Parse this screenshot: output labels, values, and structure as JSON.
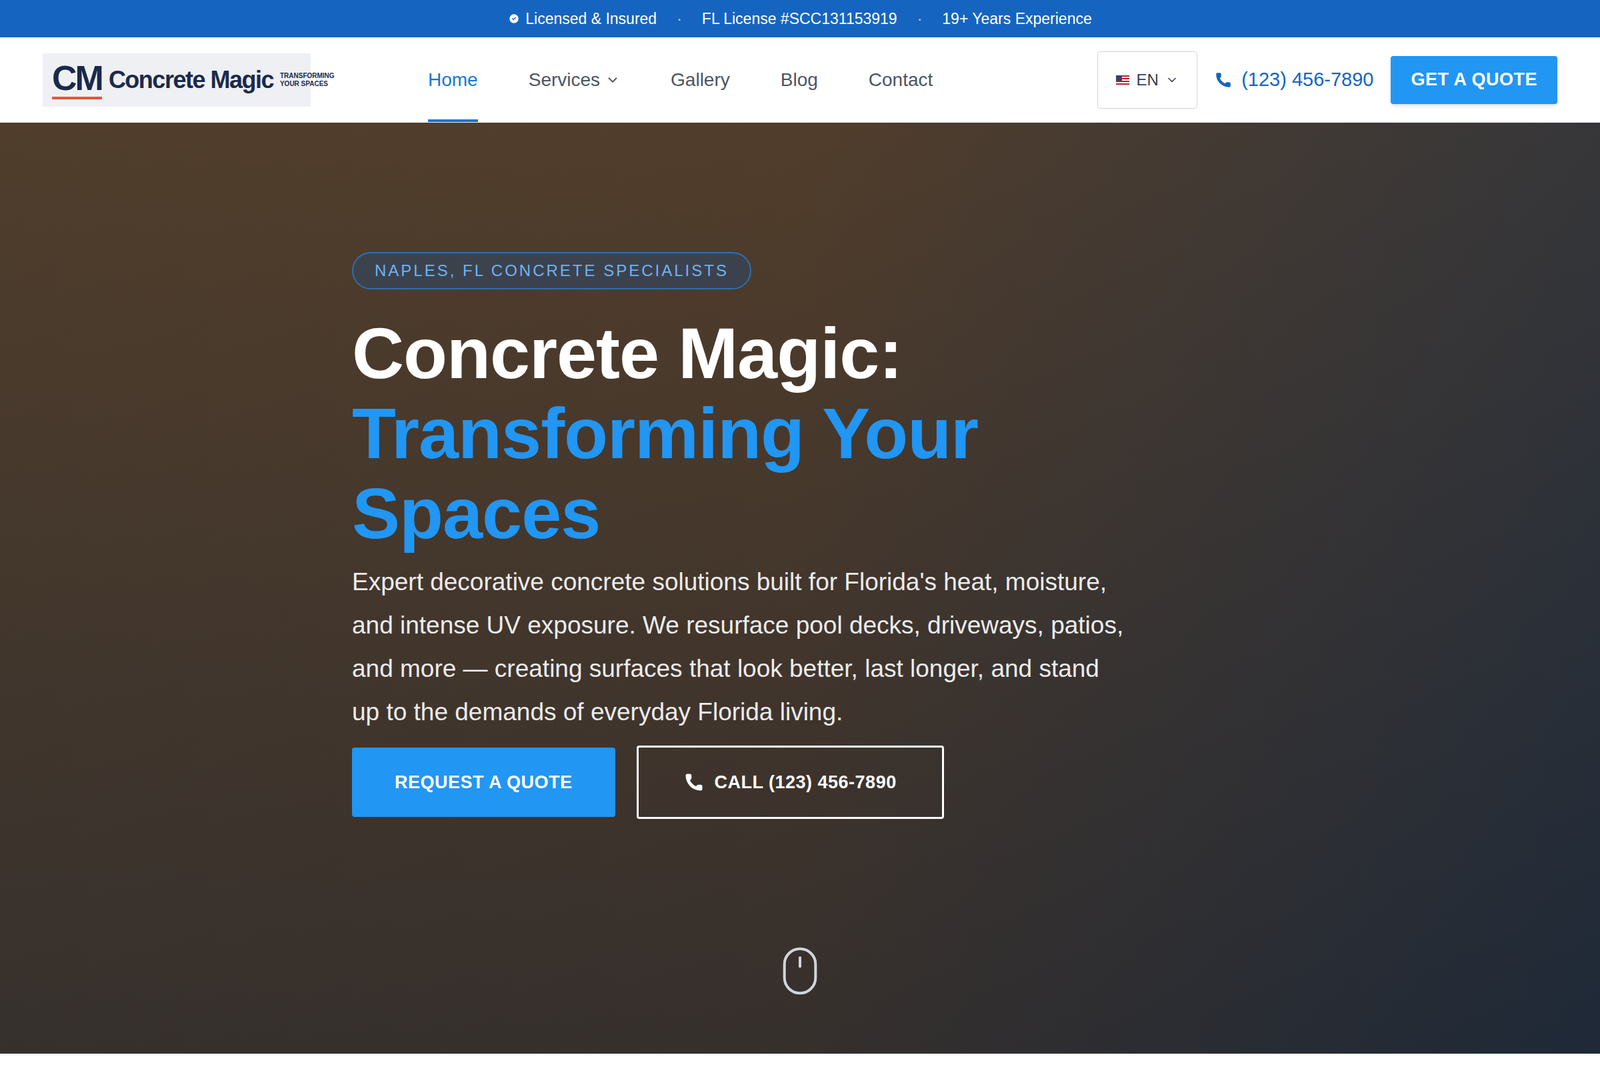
{
  "top_bar": {
    "items": [
      "Licensed & Insured",
      "FL License #SCC131153919",
      "19+ Years Experience"
    ],
    "separator": "·"
  },
  "logo": {
    "mark": "CM",
    "name": "Concrete Magic",
    "tagline": [
      "TRANSFORMING",
      "YOUR SPACES"
    ]
  },
  "nav": {
    "items": [
      {
        "label": "Home",
        "selected": true,
        "has_menu": false
      },
      {
        "label": "Services",
        "selected": false,
        "has_menu": true
      },
      {
        "label": "Gallery",
        "selected": false,
        "has_menu": false
      },
      {
        "label": "Blog",
        "selected": false,
        "has_menu": false
      },
      {
        "label": "Contact",
        "selected": false,
        "has_menu": false
      }
    ]
  },
  "language": {
    "code": "EN"
  },
  "phone": "(123) 456-7890",
  "header_button": "GET A QUOTE",
  "hero": {
    "badge": "NAPLES, FL CONCRETE SPECIALISTS",
    "title": "Concrete Magic:",
    "title_accent": "Transforming Your Spaces",
    "description": "Expert decorative concrete solutions built for Florida's heat, moisture, and intense UV exposure. We resurface pool decks, driveways, patios, and more — creating surfaces that look better, last longer, and stand up to the demands of everyday Florida living.",
    "buttons": [
      {
        "label": "REQUEST A QUOTE",
        "kind": "primary"
      },
      {
        "label": "CALL (123) 456-7890",
        "kind": "outline"
      }
    ]
  }
}
